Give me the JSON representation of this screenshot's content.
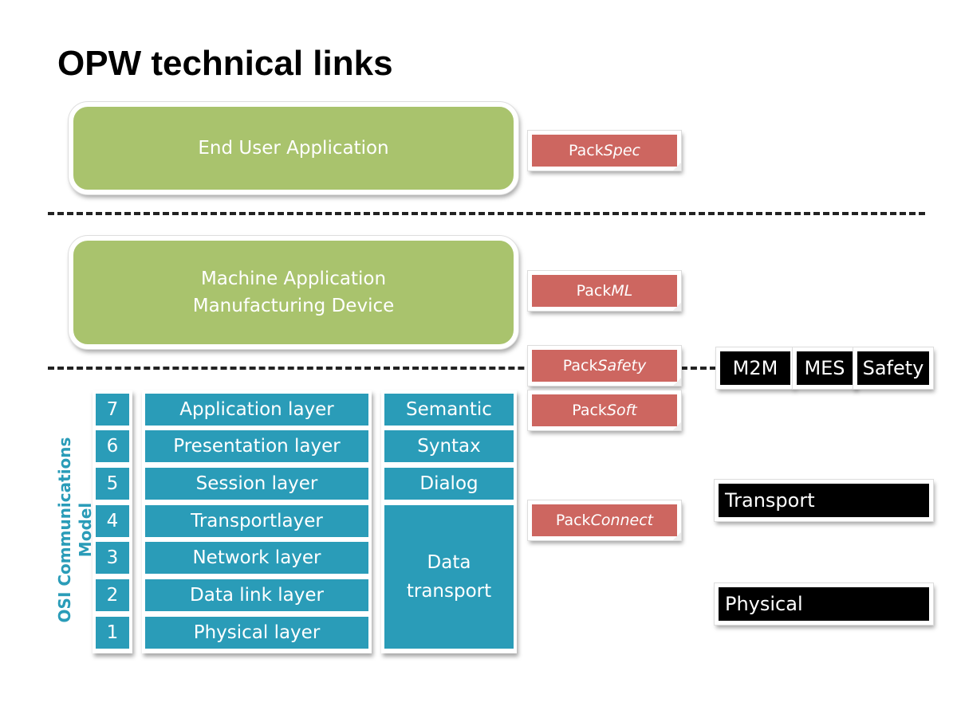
{
  "title": "OPW technical links",
  "green_boxes": {
    "end_user": "End User Application",
    "machine_line1": "Machine Application",
    "machine_line2": "Manufacturing Device"
  },
  "pack_tags": [
    {
      "prefix": "Pack",
      "suffix": "Spec"
    },
    {
      "prefix": "Pack",
      "suffix": "ML"
    },
    {
      "prefix": "Pack",
      "suffix": "Safety"
    },
    {
      "prefix": "Pack",
      "suffix": "Soft"
    },
    {
      "prefix": "Pack",
      "suffix": "Connect"
    }
  ],
  "black_tags": {
    "m2m": "M2M",
    "mes": "MES",
    "safety": "Safety",
    "transport": "Transport",
    "physical": "Physical"
  },
  "osi": {
    "label": "OSI Communications Model",
    "layers": [
      {
        "num": "7",
        "name": "Application layer"
      },
      {
        "num": "6",
        "name": "Presentation layer"
      },
      {
        "num": "5",
        "name": "Session layer"
      },
      {
        "num": "4",
        "name": "Transportlayer"
      },
      {
        "num": "3",
        "name": "Network layer"
      },
      {
        "num": "2",
        "name": "Data link layer"
      },
      {
        "num": "1",
        "name": "Physical layer"
      }
    ],
    "groups": {
      "semantic": "Semantic",
      "syntax": "Syntax",
      "dialog": "Dialog",
      "data_transport_line1": "Data",
      "data_transport_line2": "transport"
    }
  },
  "colors": {
    "green": "#a9c36d",
    "pack_red": "#cd6660",
    "teal": "#2a9cb8",
    "black": "#000000"
  }
}
